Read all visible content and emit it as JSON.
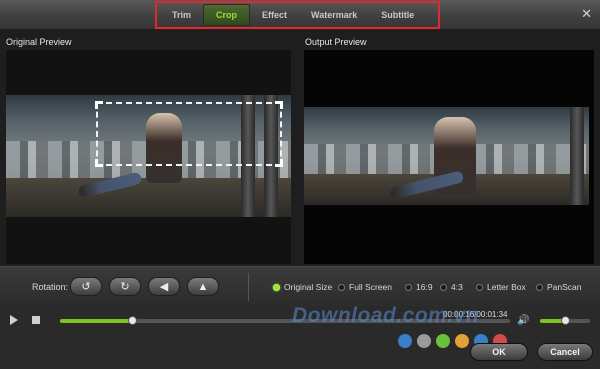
{
  "window": {
    "close_glyph": "✕"
  },
  "tabs": [
    {
      "label": "Trim",
      "active": false
    },
    {
      "label": "Crop",
      "active": true
    },
    {
      "label": "Effect",
      "active": false
    },
    {
      "label": "Watermark",
      "active": false
    },
    {
      "label": "Subtitle",
      "active": false
    }
  ],
  "previews": {
    "original_label": "Original Preview",
    "output_label": "Output Preview"
  },
  "rotation": {
    "label": "Rotation:",
    "buttons": [
      {
        "icon": "rotate-left-icon",
        "glyph": "↺"
      },
      {
        "icon": "rotate-right-icon",
        "glyph": "↻"
      },
      {
        "icon": "flip-horizontal-icon",
        "glyph": "◀"
      },
      {
        "icon": "flip-vertical-icon",
        "glyph": "▲"
      }
    ]
  },
  "aspect": {
    "options": [
      {
        "label": "Original Size",
        "selected": true
      },
      {
        "label": "Full Screen",
        "selected": false
      },
      {
        "label": "16:9",
        "selected": false
      },
      {
        "label": "4:3",
        "selected": false
      },
      {
        "label": "Letter Box",
        "selected": false
      },
      {
        "label": "PanScan",
        "selected": false
      }
    ]
  },
  "playback": {
    "timecode": "00:00:16/00:01:34",
    "progress": 0.16,
    "volume": 0.5
  },
  "watermark": {
    "text": "Download.com.vn",
    "dot_colors": [
      "#3a7fc8",
      "#9a9a9a",
      "#6cbf3a",
      "#e3a03a",
      "#3a7fc8",
      "#d34a4a"
    ]
  },
  "buttons": {
    "ok_label": "OK",
    "cancel_label": "Cancel"
  },
  "colors": {
    "accent": "#9edc3c",
    "highlight": "#e0282f"
  }
}
